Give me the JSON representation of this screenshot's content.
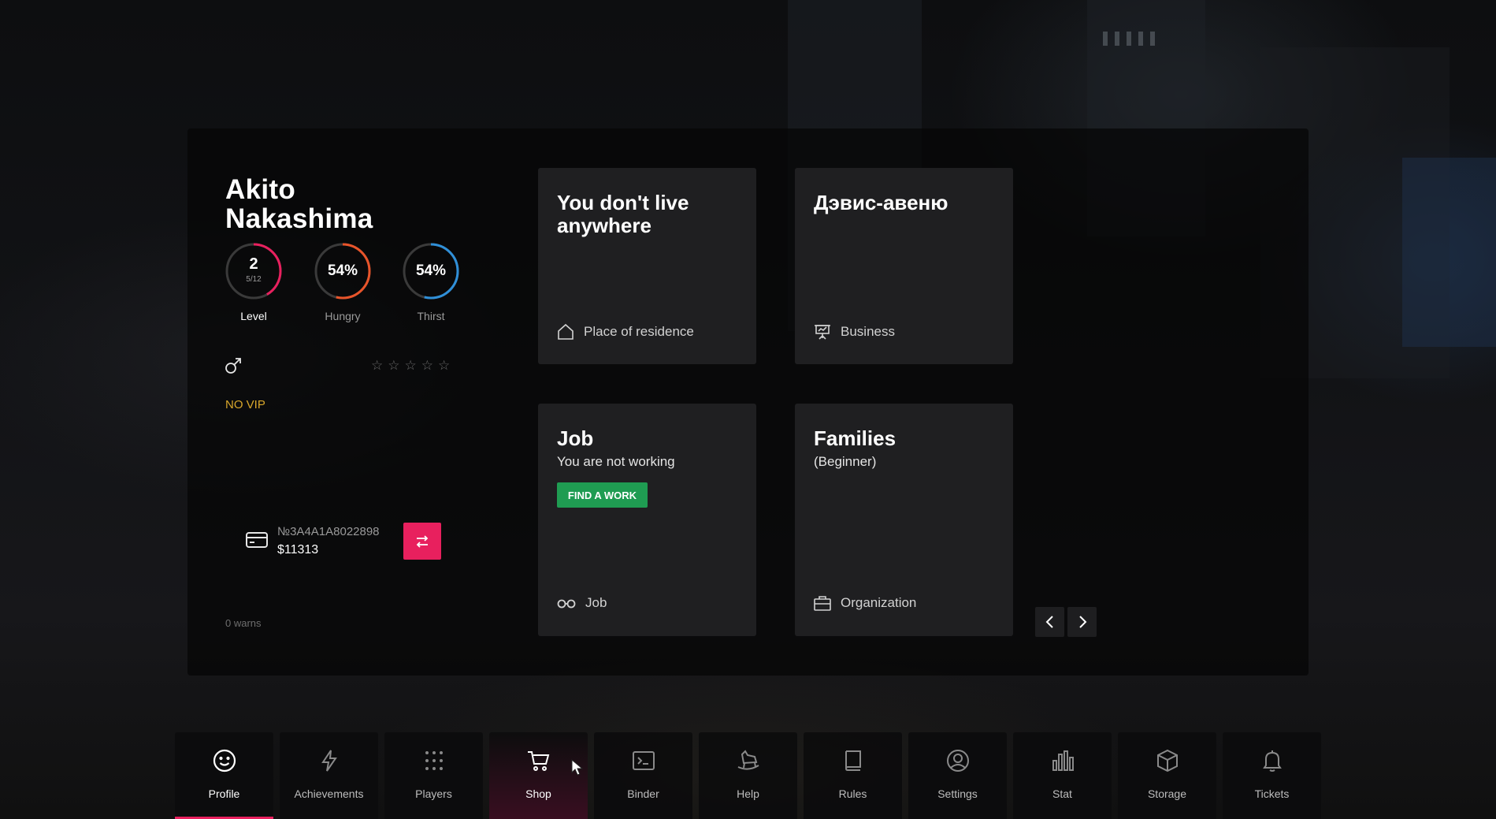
{
  "player": {
    "first_name": "Akito",
    "last_name": "Nakashima",
    "level_value": "2",
    "level_progress": "5/12",
    "level_label": "Level",
    "hungry_value": "54%",
    "hungry_label": "Hungry",
    "thirst_value": "54%",
    "thirst_label": "Thirst",
    "vip_status": "NO VIP",
    "star_rating": 0,
    "gender_icon": "male-icon"
  },
  "bank": {
    "card_number": "№3A4A1A8022898",
    "balance": "$11313"
  },
  "warns": "0 warns",
  "tiles": {
    "residence": {
      "title": "You don't live anywhere",
      "footer": "Place of residence"
    },
    "business": {
      "title": "Дэвис-авеню",
      "footer": "Business"
    },
    "job": {
      "title": "Job",
      "subtitle": "You are not working",
      "button": "FIND A WORK",
      "footer": "Job"
    },
    "family": {
      "title": "Families",
      "subtitle": "(Beginner)",
      "footer": "Organization"
    }
  },
  "colors": {
    "accent": "#e8205e",
    "success": "#1f9c52",
    "vip": "#d9a72b",
    "hungry_ring": "#e8542a",
    "thirst_ring": "#2f8fd8"
  },
  "nav": {
    "profile": "Profile",
    "achievements": "Achievements",
    "players": "Players",
    "shop": "Shop",
    "binder": "Binder",
    "help": "Help",
    "rules": "Rules",
    "settings": "Settings",
    "stat": "Stat",
    "storage": "Storage",
    "tickets": "Tickets"
  }
}
